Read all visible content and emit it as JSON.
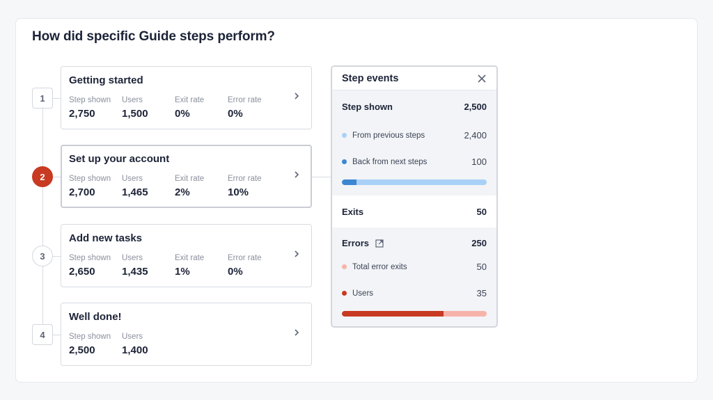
{
  "page": {
    "title": "How did specific Guide steps perform?"
  },
  "steps": [
    {
      "number": "1",
      "title": "Getting started",
      "marker_style": "square",
      "selected": false,
      "stats": [
        {
          "label": "Step shown",
          "value": "2,750"
        },
        {
          "label": "Users",
          "value": "1,500"
        },
        {
          "label": "Exit rate",
          "value": "0%"
        },
        {
          "label": "Error rate",
          "value": "0%"
        }
      ]
    },
    {
      "number": "2",
      "title": "Set up your account",
      "marker_style": "active",
      "selected": true,
      "stats": [
        {
          "label": "Step shown",
          "value": "2,700"
        },
        {
          "label": "Users",
          "value": "1,465"
        },
        {
          "label": "Exit rate",
          "value": "2%"
        },
        {
          "label": "Error rate",
          "value": "10%"
        }
      ]
    },
    {
      "number": "3",
      "title": "Add new tasks",
      "marker_style": "circle",
      "selected": false,
      "stats": [
        {
          "label": "Step shown",
          "value": "2,650"
        },
        {
          "label": "Users",
          "value": "1,435"
        },
        {
          "label": "Exit rate",
          "value": "1%"
        },
        {
          "label": "Error rate",
          "value": "0%"
        }
      ]
    },
    {
      "number": "4",
      "title": "Well done!",
      "marker_style": "square",
      "selected": false,
      "stats": [
        {
          "label": "Step shown",
          "value": "2,500"
        },
        {
          "label": "Users",
          "value": "1,400"
        }
      ]
    }
  ],
  "step_events": {
    "title": "Step events",
    "close_icon": "close-icon",
    "step_shown": {
      "label": "Step shown",
      "value": "2,500",
      "items": [
        {
          "label": "From previous steps",
          "value": "2,400",
          "color": "#a9d1f7"
        },
        {
          "label": "Back from next steps",
          "value": "100",
          "color": "#3d86d2"
        }
      ],
      "bar": {
        "highlight_fraction": 0.1,
        "highlight_color": "#3d86d2",
        "track_color": "#a9d1f7"
      }
    },
    "exits": {
      "label": "Exits",
      "value": "50"
    },
    "errors": {
      "label": "Errors",
      "link_icon": "external-link-icon",
      "value": "250",
      "items": [
        {
          "label": "Total error exits",
          "value": "50",
          "color": "#f7b3aa"
        },
        {
          "label": "Users",
          "value": "35",
          "color": "#c83a22"
        }
      ],
      "bar": {
        "highlight_fraction": 0.7,
        "highlight_color": "#c83a22",
        "track_color": "#f7b3aa"
      }
    }
  }
}
